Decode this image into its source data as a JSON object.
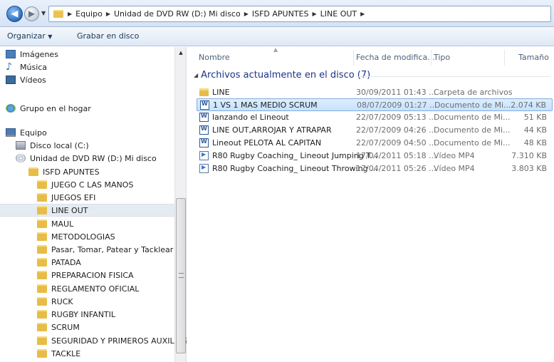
{
  "address": {
    "crumbs": [
      "Equipo",
      "Unidad de DVD RW (D:) Mi disco",
      "ISFD APUNTES",
      "LINE OUT"
    ]
  },
  "toolbar": {
    "organize": "Organizar",
    "burn": "Grabar en disco"
  },
  "nav": {
    "items": [
      {
        "label": "Imágenes",
        "icon": "images-icon"
      },
      {
        "label": "Música",
        "icon": "music-icon"
      },
      {
        "label": "Vídeos",
        "icon": "videos-icon"
      },
      {
        "label": "Grupo en el hogar",
        "icon": "homegroup-icon"
      },
      {
        "label": "Equipo",
        "icon": "computer-icon"
      },
      {
        "label": "Disco local (C:)",
        "icon": "disk-icon"
      },
      {
        "label": "Unidad de DVD RW (D:) Mi disco",
        "icon": "dvd-icon"
      },
      {
        "label": "ISFD APUNTES",
        "icon": "folder-icon"
      },
      {
        "label": "JUEGO C LAS MANOS",
        "icon": "folder-icon"
      },
      {
        "label": "JUEGOS EFI",
        "icon": "folder-icon"
      },
      {
        "label": "LINE OUT",
        "icon": "folder-icon",
        "selected": true
      },
      {
        "label": "MAUL",
        "icon": "folder-icon"
      },
      {
        "label": "METODOLOGIAS",
        "icon": "folder-icon"
      },
      {
        "label": "Pasar, Tomar, Patear y Tacklear",
        "icon": "folder-icon"
      },
      {
        "label": "PATADA",
        "icon": "folder-icon"
      },
      {
        "label": "PREPARACION FISICA",
        "icon": "folder-icon"
      },
      {
        "label": "REGLAMENTO OFICIAL",
        "icon": "folder-icon"
      },
      {
        "label": "RUCK",
        "icon": "folder-icon"
      },
      {
        "label": "RUGBY INFANTIL",
        "icon": "folder-icon"
      },
      {
        "label": "SCRUM",
        "icon": "folder-icon"
      },
      {
        "label": "SEGURIDAD Y PRIMEROS AUXILIOS",
        "icon": "folder-icon"
      },
      {
        "label": "TACKLE",
        "icon": "folder-icon"
      }
    ]
  },
  "content": {
    "columns": {
      "name": "Nombre",
      "date": "Fecha de modifica...",
      "type": "Tipo",
      "size": "Tamaño"
    },
    "group_title": "Archivos actualmente en el disco (7)",
    "files": [
      {
        "name": "LINE",
        "date": "30/09/2011 01:43 ...",
        "type": "Carpeta de archivos",
        "size": "",
        "icon": "folder-icon"
      },
      {
        "name": "1 VS 1 MAS MEDIO SCRUM",
        "date": "08/07/2009 01:27 ...",
        "type": "Documento de Mi...",
        "size": "2.074 KB",
        "icon": "word-doc-icon",
        "selected": true
      },
      {
        "name": "lanzando el Lineout",
        "date": "22/07/2009 05:13 ...",
        "type": "Documento de Mi...",
        "size": "51 KB",
        "icon": "word-doc-icon"
      },
      {
        "name": "LINE OUT,ARROJAR Y ATRAPAR",
        "date": "22/07/2009 04:26 ...",
        "type": "Documento de Mi...",
        "size": "44 KB",
        "icon": "word-doc-icon"
      },
      {
        "name": "Lineout PELOTA  AL CAPITAN",
        "date": "22/07/2009 04:50 ...",
        "type": "Documento de Mi...",
        "size": "48 KB",
        "icon": "word-doc-icon"
      },
      {
        "name": "R80 Rugby Coaching_ Lineout Jumping T...",
        "date": "17/04/2011 05:18 ...",
        "type": "Vídeo MP4",
        "size": "7.310 KB",
        "icon": "video-file-icon"
      },
      {
        "name": "R80 Rugby Coaching_ Lineout Throwing ...",
        "date": "17/04/2011 05:26 ...",
        "type": "Vídeo MP4",
        "size": "3.803 KB",
        "icon": "video-file-icon"
      }
    ]
  }
}
